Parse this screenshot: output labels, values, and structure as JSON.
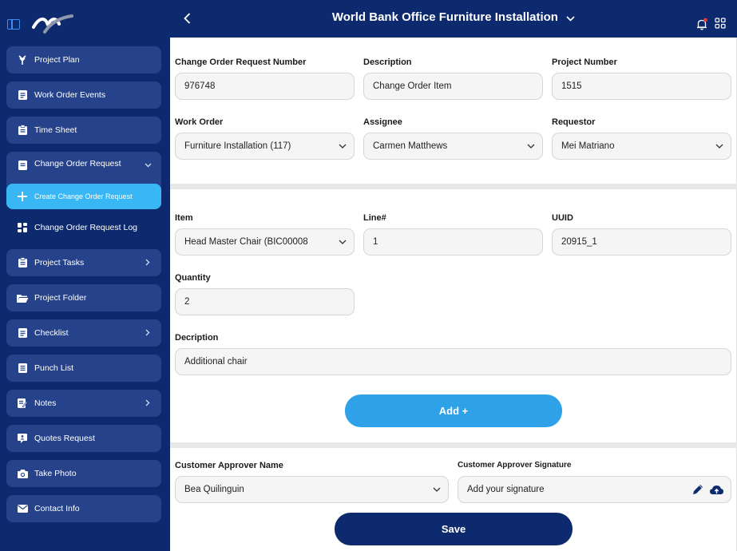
{
  "header": {
    "title": "World Bank Office Furniture Installation"
  },
  "sidebar": {
    "items": [
      {
        "label": "Project Plan",
        "icon": "project-plan-icon"
      },
      {
        "label": "Work Order Events",
        "icon": "work-order-icon"
      },
      {
        "label": "Time Sheet",
        "icon": "time-sheet-icon"
      },
      {
        "label": "Change Order Request",
        "icon": "change-order-icon",
        "expanded": true
      },
      {
        "label": "Create Change Order Request",
        "icon": "plus-icon",
        "active": true
      },
      {
        "label": "Change Order Request Log",
        "icon": "log-grid-icon"
      },
      {
        "label": "Project Tasks",
        "icon": "tasks-icon"
      },
      {
        "label": "Project Folder",
        "icon": "folder-icon"
      },
      {
        "label": "Checklist",
        "icon": "checklist-icon"
      },
      {
        "label": "Punch List",
        "icon": "punch-list-icon"
      },
      {
        "label": "Notes",
        "icon": "notes-icon"
      },
      {
        "label": "Quotes Request",
        "icon": "quotes-icon"
      },
      {
        "label": "Take Photo",
        "icon": "camera-icon"
      },
      {
        "label": "Contact Info",
        "icon": "mail-icon"
      }
    ]
  },
  "form": {
    "change_order_number": {
      "label": "Change Order Request Number",
      "value": "976748"
    },
    "description_top": {
      "label": "Description",
      "value": "Change Order Item"
    },
    "project_number": {
      "label": "Project Number",
      "value": "1515"
    },
    "work_order": {
      "label": "Work Order",
      "value": "Furniture Installation (117)"
    },
    "assignee": {
      "label": "Assignee",
      "value": "Carmen Matthews"
    },
    "requestor": {
      "label": "Requestor",
      "value": "Mei Matriano"
    },
    "item": {
      "label": "Item",
      "value": "Head Master Chair (BIC00008"
    },
    "line": {
      "label": "Line#",
      "value": "1"
    },
    "uuid": {
      "label": "UUID",
      "value": "20915_1"
    },
    "quantity": {
      "label": "Quantity",
      "value": "2"
    },
    "description_item": {
      "label": "Decription",
      "value": "Additional chair"
    },
    "add_label": "Add +",
    "approver_name": {
      "label": "Customer Approver Name",
      "value": "Bea Quilinguin"
    },
    "approver_signature": {
      "label": "Customer Approver Signature",
      "placeholder": "Add your signature"
    },
    "save_label": "Save"
  },
  "colors": {
    "navy": "#0e2a6e",
    "sidebar_button": "#25428a",
    "active_item": "#39b7f4",
    "add_button": "#2ea1e8",
    "notification_dot": "#e53935"
  }
}
